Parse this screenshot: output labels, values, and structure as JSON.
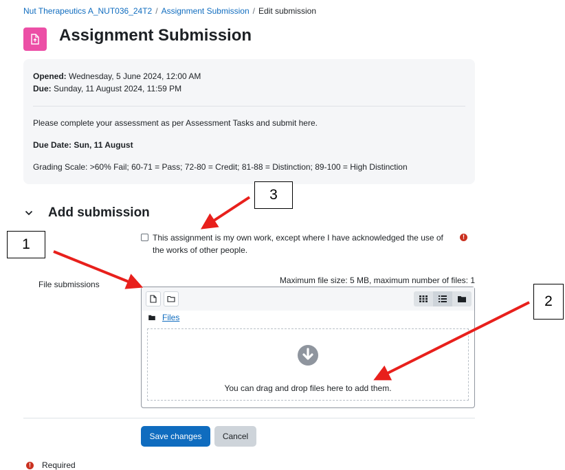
{
  "breadcrumb": {
    "course": "Nut Therapeutics A_NUT036_24T2",
    "sep1": "/",
    "activity": "Assignment Submission",
    "sep2": "/",
    "current": "Edit submission"
  },
  "page": {
    "title": "Assignment Submission",
    "icon": "assignment-upload-icon",
    "icon_color": "#ec4fa6"
  },
  "info": {
    "opened_label": "Opened:",
    "opened_value": "Wednesday, 5 June 2024, 12:00 AM",
    "due_label": "Due:",
    "due_value": "Sunday, 11 August 2024, 11:59 PM",
    "description": "Please complete your assessment as per Assessment Tasks and submit here.",
    "due_date_line": "Due Date:  Sun, 11 August",
    "grading_scale": "Grading Scale: >60% Fail; 60-71 = Pass; 72-80 = Credit; 81-88 = Distinction; 89-100 = High Distinction"
  },
  "submission": {
    "section_title": "Add submission",
    "statement": "This assignment is my own work, except where I have acknowledged the use of the works of other people.",
    "statement_checked": false,
    "file_label": "File submissions",
    "max_info": "Maximum file size: 5 MB, maximum number of files: 1",
    "path_label": "Files",
    "drop_text": "You can drag and drop files here to add them."
  },
  "buttons": {
    "save": "Save changes",
    "cancel": "Cancel"
  },
  "footer": {
    "required_icon_text": "!",
    "required_label": "Required"
  },
  "callouts": {
    "one": "1",
    "two": "2",
    "three": "3"
  },
  "colors": {
    "primary": "#0f6cbf",
    "required": "#ca3120",
    "arrow": "#e8201c"
  }
}
